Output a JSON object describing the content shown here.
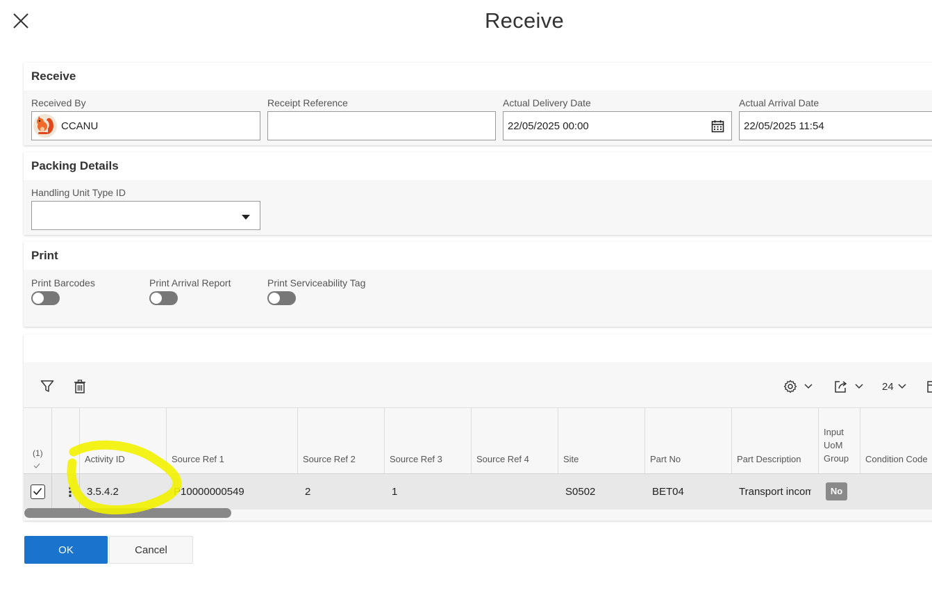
{
  "dialog": {
    "title": "Receive",
    "close_icon": "close-icon"
  },
  "receive_panel": {
    "title": "Receive",
    "fields": {
      "received_by": {
        "label": "Received By",
        "value": "CCANU",
        "avatar_icon": "squirrel-avatar-icon"
      },
      "receipt_reference": {
        "label": "Receipt Reference",
        "value": ""
      },
      "actual_delivery_date": {
        "label": "Actual Delivery Date",
        "value": "22/05/2025 00:00",
        "icon": "calendar-icon"
      },
      "actual_arrival_date": {
        "label": "Actual Arrival Date",
        "value": "22/05/2025 11:54"
      }
    }
  },
  "packing_panel": {
    "title": "Packing Details",
    "handling_unit_type": {
      "label": "Handling Unit Type ID",
      "value": ""
    }
  },
  "print_panel": {
    "title": "Print",
    "toggles": [
      {
        "label": "Print Barcodes",
        "on": false
      },
      {
        "label": "Print Arrival Report",
        "on": false
      },
      {
        "label": "Print Serviceability Tag",
        "on": false
      }
    ]
  },
  "grid": {
    "toolbar": {
      "filter_icon": "filter-icon",
      "delete_icon": "trash-icon",
      "settings_icon": "gear-icon",
      "export_icon": "export-icon",
      "page_size": "24"
    },
    "selected_count": "(1)",
    "columns": [
      "Activity ID",
      "Source Ref 1",
      "Source Ref 2",
      "Source Ref 3",
      "Source Ref 4",
      "Site",
      "Part No",
      "Part Description",
      "Input UoM Group",
      "Condition Code"
    ],
    "input_uom_lines": [
      "Input",
      "UoM",
      "Group"
    ],
    "rows": [
      {
        "activity_id": "3.5.4.2",
        "source_ref_1": "P10000000549",
        "source_ref_2": "2",
        "source_ref_3": "1",
        "source_ref_4": "",
        "site": "S0502",
        "part_no": "BET04",
        "part_description": "Transport incoming",
        "input_uom_group": "No",
        "condition_code": ""
      }
    ]
  },
  "footer": {
    "ok_label": "OK",
    "cancel_label": "Cancel"
  },
  "colors": {
    "primary": "#1a73cc",
    "highlight": "#f5f500"
  }
}
